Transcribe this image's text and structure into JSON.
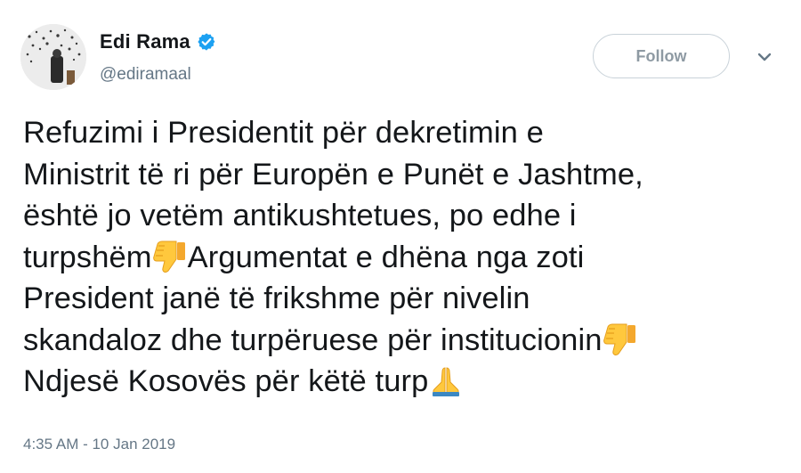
{
  "author": {
    "name": "Edi Rama",
    "handle": "@ediramaal",
    "verified": true
  },
  "follow_button": {
    "label": "Follow"
  },
  "icons": {
    "verified": "verified-badge-icon",
    "more": "chevron-down-icon",
    "thumbs_down": "thumbs-down-emoji",
    "pray": "folded-hands-emoji"
  },
  "tweet": {
    "lines": [
      "Refuzimi i Presidentit për dekretimin e",
      "Ministrit të ri për Europën e Punët e Jashtme,",
      "është jo vetëm antikushtetues, po edhe i",
      "turpshëm",
      "Argumentat e dhëna nga zoti",
      "President janë të frikshme për nivelin",
      "skandaloz dhe turpëruese për institucionin",
      "Ndjesë Kosovës për këtë turp"
    ],
    "timestamp": "4:35 AM - 10 Jan 2019"
  },
  "colors": {
    "text": "#14171a",
    "secondary": "#657786",
    "verified_blue": "#1da1f2",
    "emoji_yellow": "#ffc83d"
  }
}
